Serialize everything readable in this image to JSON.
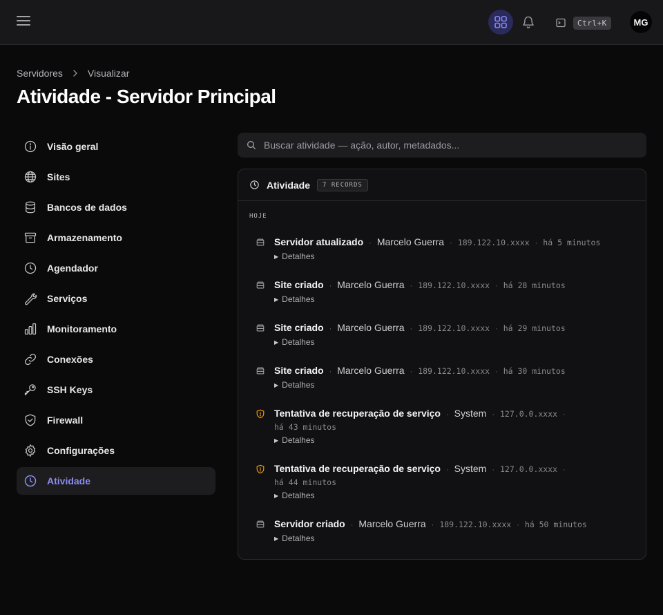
{
  "topbar": {
    "kbd_shortcut": "Ctrl+K",
    "avatar_initials": "MG"
  },
  "breadcrumb": [
    "Servidores",
    "Visualizar"
  ],
  "page_title": "Atividade - Servidor Principal",
  "sidebar": {
    "items": [
      {
        "label": "Visão geral",
        "icon": "info-icon"
      },
      {
        "label": "Sites",
        "icon": "globe-icon"
      },
      {
        "label": "Bancos de dados",
        "icon": "database-icon"
      },
      {
        "label": "Armazenamento",
        "icon": "archive-icon"
      },
      {
        "label": "Agendador",
        "icon": "clock-icon"
      },
      {
        "label": "Serviços",
        "icon": "wrench-icon"
      },
      {
        "label": "Monitoramento",
        "icon": "bar-chart-icon"
      },
      {
        "label": "Conexões",
        "icon": "link-icon"
      },
      {
        "label": "SSH Keys",
        "icon": "key-icon"
      },
      {
        "label": "Firewall",
        "icon": "shield-check-icon"
      },
      {
        "label": "Configurações",
        "icon": "gear-icon"
      },
      {
        "label": "Atividade",
        "icon": "clock-icon",
        "active": true
      }
    ]
  },
  "search": {
    "placeholder": "Buscar atividade — ação, autor, metadados..."
  },
  "activity": {
    "title": "Atividade",
    "badge": "7 RECORDS",
    "section_label": "HOJE",
    "details_label": "Detalhes",
    "entries": [
      {
        "action": "Servidor atualizado",
        "actor": "Marcelo Guerra",
        "ip": "189.122.10.xxxx",
        "time": "há 5 minutos",
        "icon": "server-icon"
      },
      {
        "action": "Site criado",
        "actor": "Marcelo Guerra",
        "ip": "189.122.10.xxxx",
        "time": "há 28 minutos",
        "icon": "server-icon"
      },
      {
        "action": "Site criado",
        "actor": "Marcelo Guerra",
        "ip": "189.122.10.xxxx",
        "time": "há 29 minutos",
        "icon": "server-icon"
      },
      {
        "action": "Site criado",
        "actor": "Marcelo Guerra",
        "ip": "189.122.10.xxxx",
        "time": "há 30 minutos",
        "icon": "server-icon"
      },
      {
        "action": "Tentativa de recuperação de serviço",
        "actor": "System",
        "ip": "127.0.0.xxxx",
        "time": "há 43 minutos",
        "icon": "shield-alert-icon"
      },
      {
        "action": "Tentativa de recuperação de serviço",
        "actor": "System",
        "ip": "127.0.0.xxxx",
        "time": "há 44 minutos",
        "icon": "shield-alert-icon"
      },
      {
        "action": "Servidor criado",
        "actor": "Marcelo Guerra",
        "ip": "189.122.10.xxxx",
        "time": "há 50 minutos",
        "icon": "server-icon"
      }
    ]
  },
  "colors": {
    "accent": "#8b8cf0",
    "warning": "#f59e0b"
  }
}
